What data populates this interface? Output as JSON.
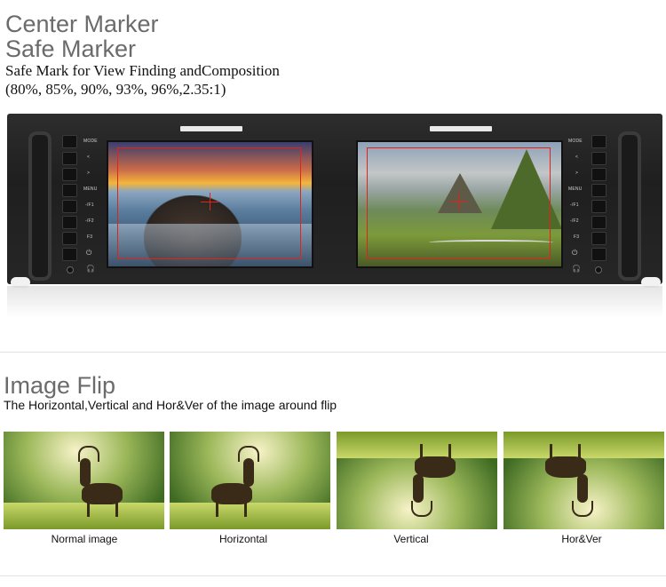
{
  "header": {
    "title1": "Center Marker",
    "title2": "Safe Marker",
    "line1": "Safe Mark for View Finding andComposition",
    "line2": "(80%, 85%, 90%, 93%, 96%,2.35:1)"
  },
  "monitor": {
    "left_buttons": [
      "MODE",
      "<",
      ">",
      "MENU",
      "-/F1",
      "-/F2",
      "F3",
      "power-icon"
    ],
    "right_buttons": [
      "MODE",
      "<",
      ">",
      "MENU",
      "-/F1",
      "-/F2",
      "F3",
      "power-icon"
    ]
  },
  "flip": {
    "title": "Image Flip",
    "subtitle": "The Horizontal,Vertical and Hor&Ver of the image around flip",
    "captions": [
      "Normal image",
      "Horizontal",
      "Vertical",
      "Hor&Ver"
    ]
  },
  "colors": {
    "marker": "#e0241c",
    "rack": "#252525"
  }
}
